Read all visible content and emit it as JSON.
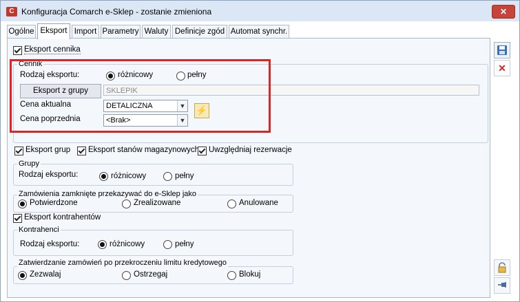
{
  "window": {
    "title": "Konfiguracja Comarch e-Sklep - zostanie zmieniona",
    "close": "✕"
  },
  "tabs": [
    {
      "label": "Ogólne"
    },
    {
      "label": "Eksport",
      "active": true
    },
    {
      "label": "Import"
    },
    {
      "label": "Parametry"
    },
    {
      "label": "Waluty"
    },
    {
      "label": "Definicje zgód"
    },
    {
      "label": "Automat synchr."
    }
  ],
  "eksport_cennika": {
    "label": "Eksport cennika",
    "checked": true
  },
  "cennik": {
    "title": "Cennik",
    "rodzaj_label": "Rodzaj eksportu:",
    "opt_roznicowy": "różnicowy",
    "opt_pelny": "pełny",
    "selected": "różnicowy",
    "group_button": "Eksport z grupy",
    "group_value": "SKLEPIK",
    "cena_aktualna_label": "Cena aktualna",
    "cena_aktualna_value": "DETALICZNA",
    "cena_poprzednia_label": "Cena poprzednia",
    "cena_poprzednia_value": "<Brak>"
  },
  "checks_row": {
    "eksport_grup": "Eksport grup",
    "eksport_stanow": "Eksport stanów magazynowych",
    "uwzgledniaj": "Uwzględniaj rezerwacje"
  },
  "grupy": {
    "title": "Grupy",
    "rodzaj_label": "Rodzaj eksportu:",
    "opt_roznicowy": "różnicowy",
    "opt_pelny": "pełny",
    "selected": "różnicowy"
  },
  "zamowienia": {
    "title": "Zamówienia zamknięte przekazywać do e-Sklep jako",
    "opt1": "Potwierdzone",
    "opt2": "Zrealizowane",
    "opt3": "Anulowane",
    "selected": "Potwierdzone"
  },
  "eksport_kontrahentow": {
    "label": "Eksport kontrahentów",
    "checked": true
  },
  "kontrahenci": {
    "title": "Kontrahenci",
    "rodzaj_label": "Rodzaj eksportu:",
    "opt_roznicowy": "różnicowy",
    "opt_pelny": "pełny",
    "selected": "różnicowy"
  },
  "zatwierdzanie": {
    "title": "Zatwierdzanie zamówień po przekroczeniu limitu kredytowego",
    "opt1": "Zezwalaj",
    "opt2": "Ostrzegaj",
    "opt3": "Blokuj",
    "selected": "Zezwalaj"
  },
  "side_icons": [
    "save-icon",
    "delete-icon",
    "lock-icon",
    "pin-icon"
  ]
}
